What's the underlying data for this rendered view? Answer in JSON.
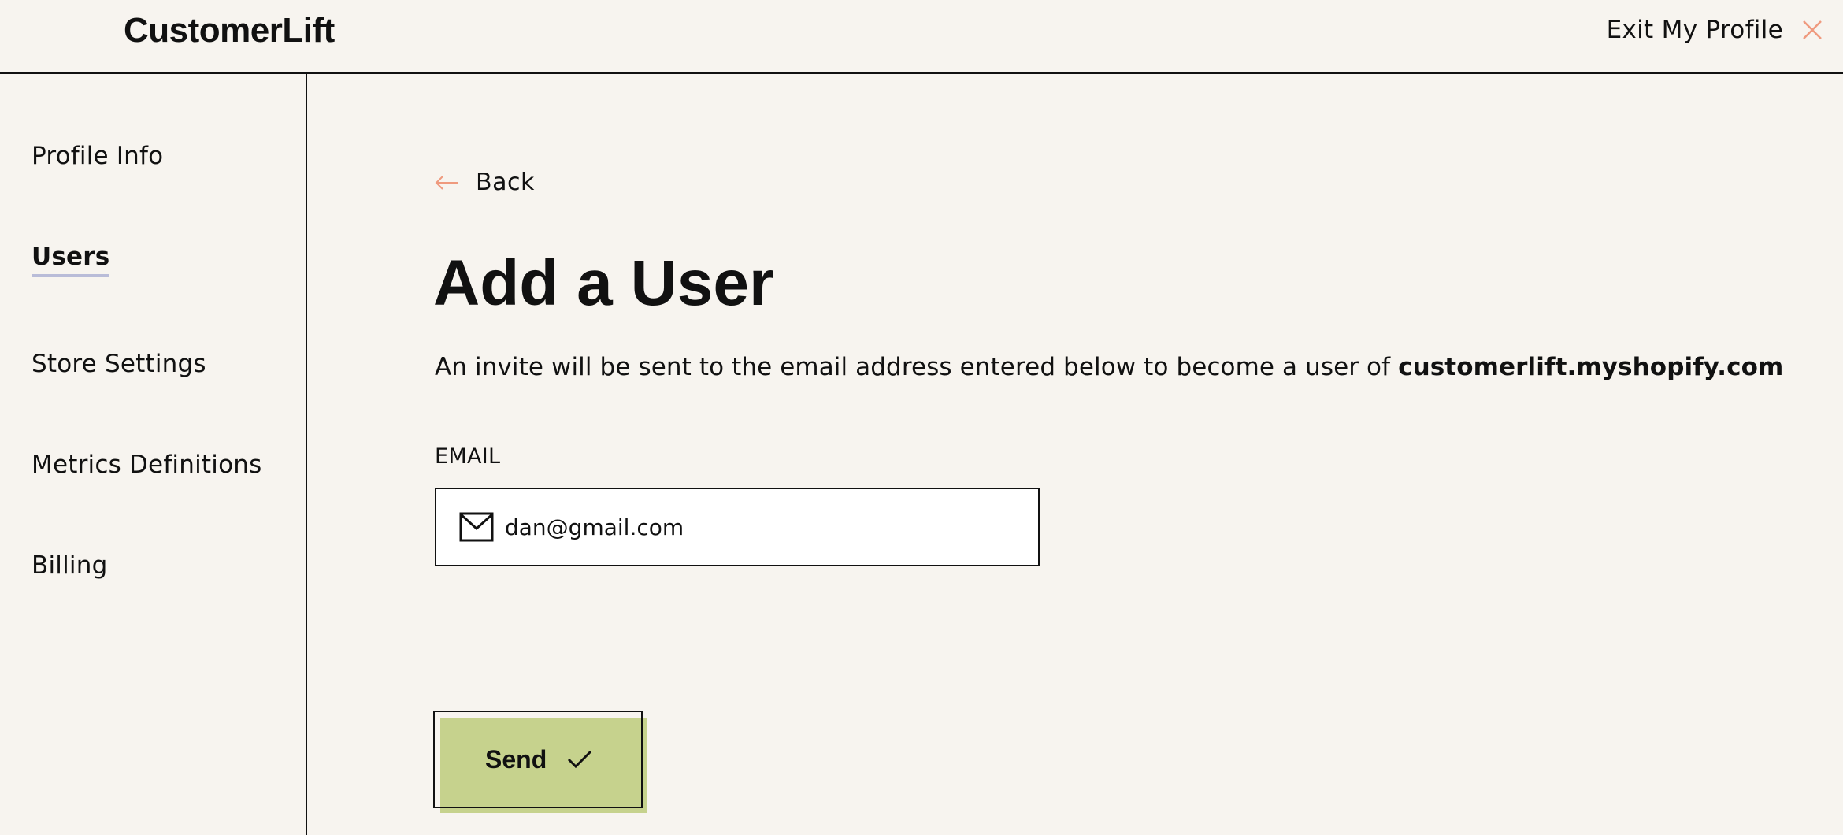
{
  "header": {
    "logo": "CustomerLift",
    "exit_label": "Exit My Profile",
    "exit_icon": "close-icon"
  },
  "sidebar": {
    "items": [
      {
        "label": "Profile Info",
        "active": false
      },
      {
        "label": "Users",
        "active": true
      },
      {
        "label": "Store Settings",
        "active": false
      },
      {
        "label": "Metrics Definitions",
        "active": false
      },
      {
        "label": "Billing",
        "active": false
      }
    ]
  },
  "main": {
    "back_label": "Back",
    "back_icon": "arrow-left-icon",
    "title": "Add a User",
    "description_prefix": "An invite will be sent to the email address entered below to become a user of ",
    "description_store": "customerlift.myshopify.com",
    "email_label": "EMAIL",
    "email_value": "dan@gmail.com",
    "email_icon": "mail-icon",
    "send_label": "Send",
    "send_icon": "check-icon"
  },
  "colors": {
    "background": "#f7f4ef",
    "accent_orange": "#ef9a7e",
    "send_green": "#c6d28d",
    "active_underline": "#b9bcd8",
    "text": "#111111"
  }
}
